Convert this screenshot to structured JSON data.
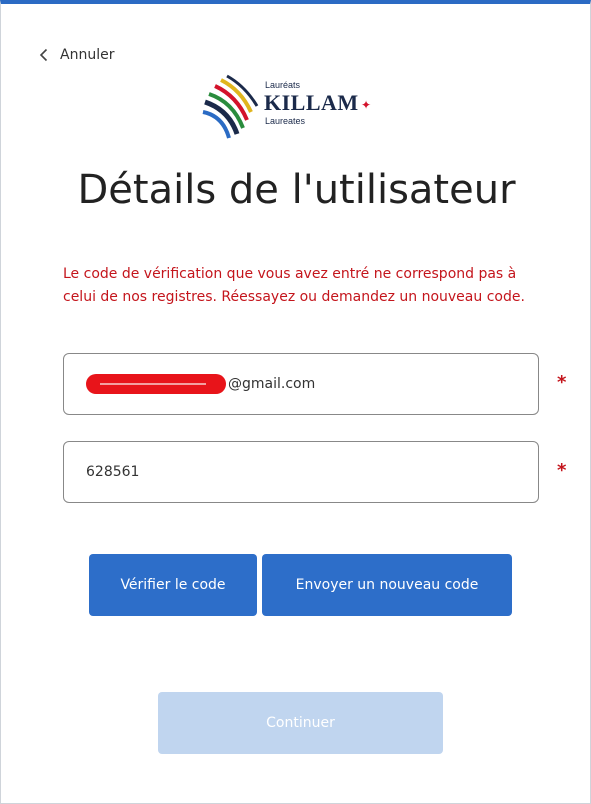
{
  "header": {
    "cancel_label": "Annuler"
  },
  "logo": {
    "top_word": "Lauréats",
    "main_word": "KILLAM",
    "bottom_word": "Laureates"
  },
  "title": "Détails de l'utilisateur",
  "error_message": "Le code de vérification que vous avez entré ne correspond pas à celui de nos registres. Réessayez ou demandez un nouveau code.",
  "form": {
    "email_suffix": "@gmail.com",
    "code_value": "628561",
    "required_marker": "*"
  },
  "buttons": {
    "verify_label": "Vérifier le code",
    "resend_label": "Envoyer un nouveau code",
    "continue_label": "Continuer"
  },
  "colors": {
    "accent": "#2d6ec9",
    "error": "#c4151c",
    "disabled": "#c0d5ef",
    "brand_red": "#d3122b"
  }
}
